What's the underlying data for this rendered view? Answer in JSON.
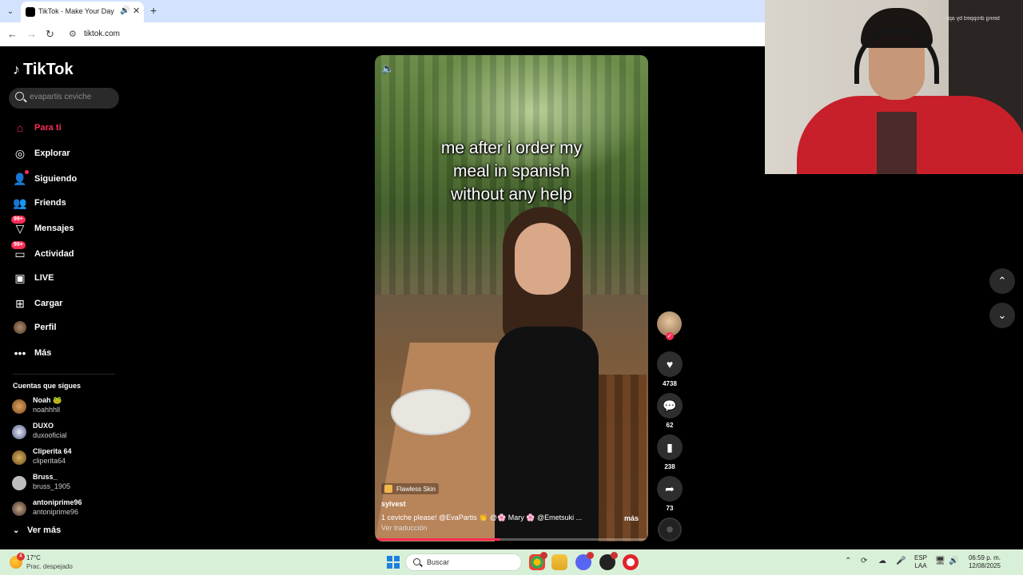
{
  "browser": {
    "tab_title": "TikTok - Make Your Day",
    "url": "tiktok.com"
  },
  "sidebar": {
    "logo": "TikTok",
    "search_placeholder": "evapartis ceviche",
    "nav": [
      {
        "label": "Para ti",
        "icon": "home-icon",
        "active": true
      },
      {
        "label": "Explorar",
        "icon": "compass-icon"
      },
      {
        "label": "Siguiendo",
        "icon": "following-icon"
      },
      {
        "label": "Friends",
        "icon": "friends-icon"
      },
      {
        "label": "Mensajes",
        "icon": "messages-icon",
        "badge": "99+"
      },
      {
        "label": "Actividad",
        "icon": "activity-icon",
        "badge": "99+"
      },
      {
        "label": "LIVE",
        "icon": "live-icon"
      },
      {
        "label": "Cargar",
        "icon": "upload-icon"
      },
      {
        "label": "Perfil",
        "icon": "profile-avatar"
      },
      {
        "label": "Más",
        "icon": "more-icon"
      }
    ],
    "following_title": "Cuentas que sigues",
    "accounts": [
      {
        "name": "Noah 🐸",
        "handle": "noahhhll"
      },
      {
        "name": "DUXO",
        "handle": "duxooficial"
      },
      {
        "name": "Cliperita 64",
        "handle": "cliperita64"
      },
      {
        "name": "Bruss_",
        "handle": "bruss_1905"
      },
      {
        "name": "antoniprime96",
        "handle": "antoniprime96"
      }
    ],
    "see_more": "Ver más"
  },
  "video": {
    "caption_lines": [
      "me after i order my",
      "meal in spanish",
      "without any help"
    ],
    "effect": "Flawless Skin",
    "author": "sylvest",
    "description": "1 ceviche please! @EvaPartis 👏 @🌸 Mary 🌸 @Emetsuki ...",
    "more": "más",
    "translate": "Ver traducción",
    "progress": 0.46
  },
  "actions": {
    "likes": "4738",
    "comments": "62",
    "saves": "238",
    "shares": "73"
  },
  "webcam": {
    "watermark": "being dropped by app"
  },
  "taskbar": {
    "temp": "17°C",
    "weather_desc": "Prac. despejado",
    "weather_badge": "4",
    "search": "Buscar",
    "lang_1": "ESP",
    "lang_2": "LAA",
    "time": "06:59 p. m.",
    "date": "12/08/2025"
  }
}
